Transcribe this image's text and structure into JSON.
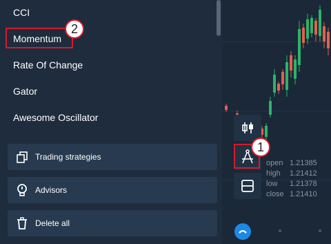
{
  "indicators": [
    {
      "label": "CCI"
    },
    {
      "label": "Momentum"
    },
    {
      "label": "Rate Of Change"
    },
    {
      "label": "Gator"
    },
    {
      "label": "Awesome Oscillator"
    }
  ],
  "actions": {
    "strategies": "Trading strategies",
    "advisors": "Advisors",
    "delete": "Delete all"
  },
  "badges": {
    "one": "1",
    "two": "2"
  },
  "ohlc": {
    "open_label": "open",
    "open": "1.21385",
    "high_label": "high",
    "high": "1.21412",
    "low_label": "low",
    "low": "1.21378",
    "close_label": "close",
    "close": "1.21410"
  },
  "icons": {
    "strategies": "copy-icon",
    "advisors": "lightbulb-icon",
    "delete": "trash-icon",
    "tool_candles": "candlestick-icon",
    "tool_draw": "drawing-compass-icon",
    "tool_layout": "split-layout-icon"
  },
  "colors": {
    "up": "#2db36b",
    "down": "#e0614f",
    "highlight": "#d8192a",
    "accent": "#1e88e5"
  }
}
